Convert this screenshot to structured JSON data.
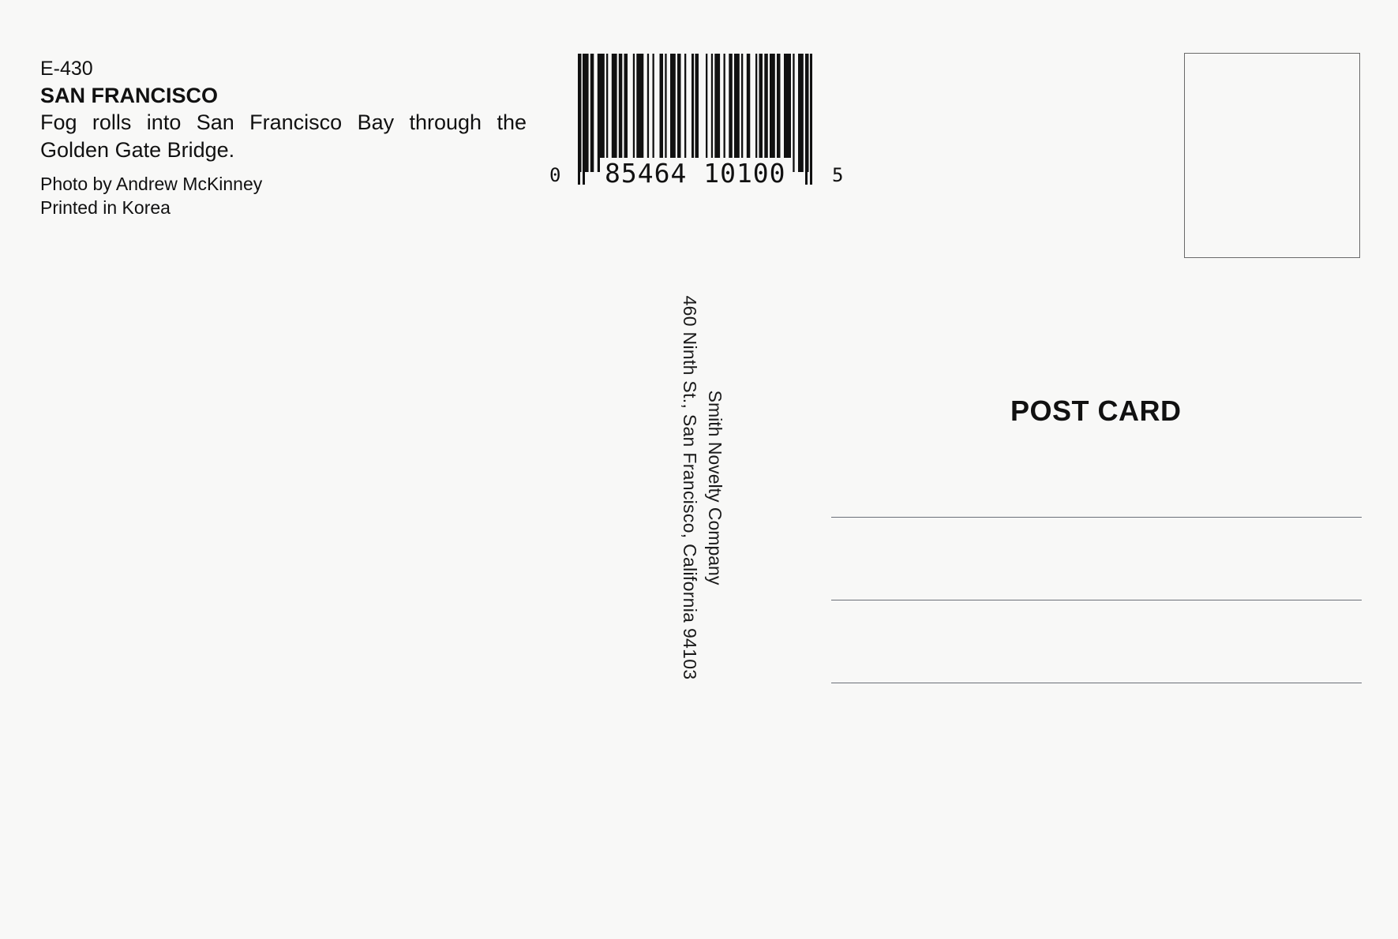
{
  "caption": {
    "code": "E-430",
    "title": "SAN FRANCISCO",
    "description": "Fog rolls into San Francisco Bay through the Golden Gate Bridge.",
    "photo_credit": "Photo by Andrew McKinney",
    "printed_in": "Printed in Korea"
  },
  "barcode": {
    "lead_digit": "0",
    "main_digits": "85464 10100",
    "trail_digit": "5"
  },
  "publisher": {
    "name": "Smith Novelty Company",
    "address": "460 Ninth St., San Francisco, California  94103"
  },
  "postcard_label": "POST CARD",
  "colors": {
    "paper": "#f8f8f7",
    "ink": "#111111",
    "rule": "#6b6f78"
  }
}
